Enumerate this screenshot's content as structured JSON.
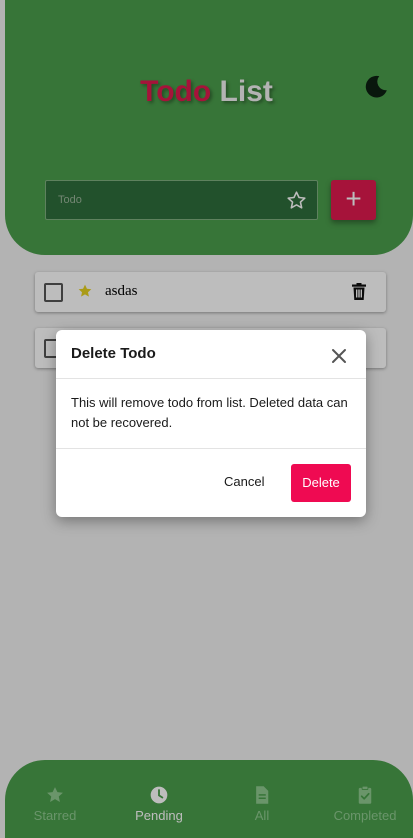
{
  "header": {
    "title_part1": "Todo",
    "title_part2": "List",
    "theme_icon": "moon-icon"
  },
  "input": {
    "placeholder": "Todo",
    "star_icon": "star-outline-icon",
    "add_icon": "plus-icon",
    "add_label": "+"
  },
  "todos": [
    {
      "text": "asdas",
      "starred": true,
      "completed": false
    },
    {
      "text": "",
      "starred": false,
      "completed": false
    }
  ],
  "nav": [
    {
      "label": "Starred",
      "icon": "star-icon",
      "active": false
    },
    {
      "label": "Pending",
      "icon": "clock-icon",
      "active": true
    },
    {
      "label": "All",
      "icon": "document-icon",
      "active": false
    },
    {
      "label": "Completed",
      "icon": "clipboard-check-icon",
      "active": false
    }
  ],
  "dialog": {
    "title": "Delete Todo",
    "message": "This will remove todo from list. Deleted data can not be recovered.",
    "cancel_label": "Cancel",
    "delete_label": "Delete"
  },
  "colors": {
    "primary_green": "#4b9e4c",
    "accent_red": "#e01a4f",
    "delete_button": "#ef0a52",
    "star_yellow": "#e6d21f"
  }
}
